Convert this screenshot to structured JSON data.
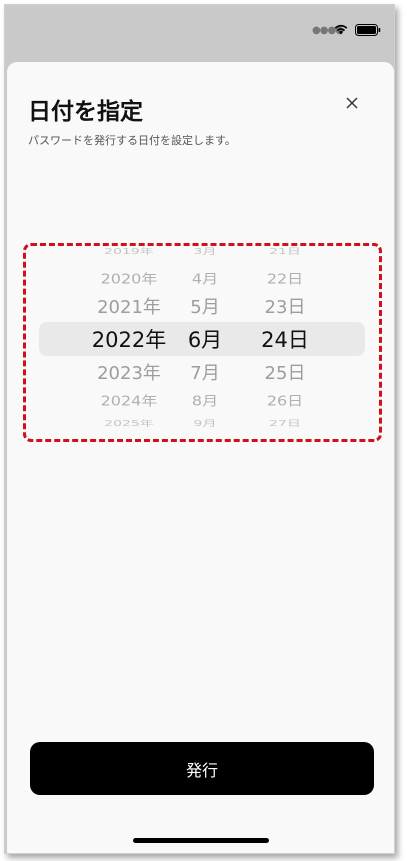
{
  "sheet": {
    "title": "日付を指定",
    "subtitle": "パスワードを発行する日付を設定します。"
  },
  "picker": {
    "years": [
      "2019年",
      "2020年",
      "2021年",
      "2022年",
      "2023年",
      "2024年",
      "2025年"
    ],
    "months": [
      "3月",
      "4月",
      "5月",
      "6月",
      "7月",
      "8月",
      "9月"
    ],
    "days": [
      "21日",
      "22日",
      "23日",
      "24日",
      "25日",
      "26日",
      "27日"
    ],
    "selected": {
      "year": "2022年",
      "month": "6月",
      "day": "24日"
    }
  },
  "actions": {
    "issue_label": "発行"
  },
  "icons": {
    "close": "close-icon",
    "wifi": "wifi-icon",
    "battery": "battery-icon"
  },
  "colors": {
    "highlight": "#d0101a",
    "button_bg": "#000000",
    "button_text": "#ffffff"
  }
}
